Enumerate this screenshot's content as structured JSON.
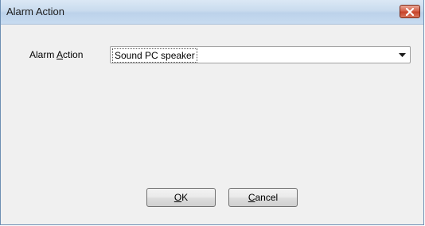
{
  "window": {
    "title": "Alarm Action"
  },
  "form": {
    "label_prefix": "Alarm ",
    "label_mnemonic": "A",
    "label_rest": "ction",
    "combo_value": "Sound PC speaker"
  },
  "buttons": {
    "ok_mnemonic": "O",
    "ok_rest": "K",
    "cancel_mnemonic": "C",
    "cancel_rest": "ancel"
  },
  "icons": {
    "close": "close-icon",
    "dropdown": "chevron-down-icon"
  },
  "colors": {
    "close_button": "#c7432a",
    "titlebar": "#c9dbee"
  }
}
